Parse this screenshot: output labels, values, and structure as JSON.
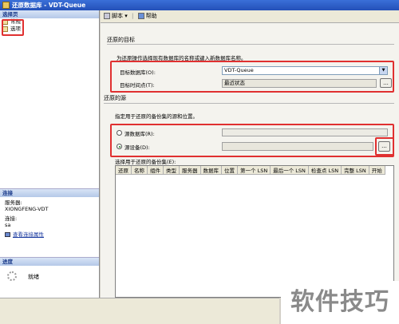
{
  "window": {
    "title": "还原数据库 - VDT-Queue"
  },
  "left_pane": {
    "select_page_header": "选择页",
    "pages": [
      {
        "label": "常规"
      },
      {
        "label": "选项"
      }
    ],
    "connection_header": "连接",
    "server_label": "服务器:",
    "server_value": "XIONGFENG-VDT",
    "connection_label": "连接:",
    "connection_value": "sa",
    "view_connection_link": "查看连接属性",
    "progress_header": "进度",
    "progress_status": "就绪"
  },
  "toolbar": {
    "script_label": "脚本",
    "help_label": "帮助"
  },
  "restore_target": {
    "section_title": "还原的目标",
    "description": "为还原操作选择现有数据库的名称或键入新数据库名称。",
    "target_db_label": "目标数据库(O):",
    "target_db_value": "VDT-Queue",
    "point_in_time_label": "目标时间点(T):",
    "point_in_time_value": "最近状态",
    "browse_label": "..."
  },
  "restore_source": {
    "section_title": "还原的源",
    "description": "指定用于还原的备份集的源和位置。",
    "from_db_label": "源数据库(R):",
    "from_device_label": "源设备(D):",
    "from_device_value": "",
    "browse_label": "..."
  },
  "backup_sets": {
    "label": "选择用于还原的备份集(E):",
    "columns": [
      "还原",
      "名称",
      "组件",
      "类型",
      "服务器",
      "数据库",
      "位置",
      "第一个 LSN",
      "最后一个 LSN",
      "检查点 LSN",
      "完整 LSN",
      "开始"
    ]
  },
  "watermark": "软件技巧",
  "colors": {
    "highlight": "#e03030",
    "title_bar": "#2e5fc8"
  }
}
